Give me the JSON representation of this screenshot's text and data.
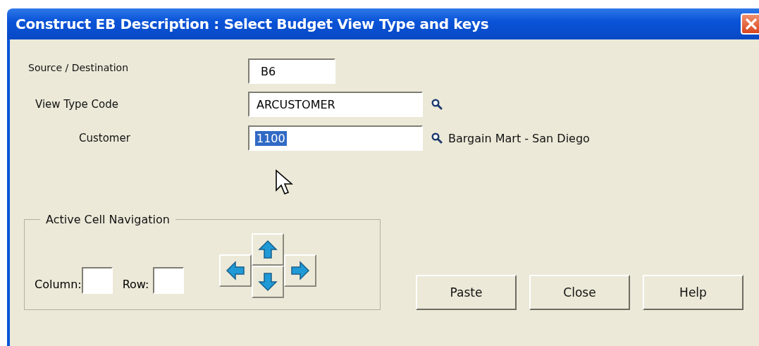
{
  "window": {
    "title": "Construct EB Description : Select Budget View Type and keys"
  },
  "fields": [
    {
      "kind": "short",
      "label": "Source / Destination",
      "value": "B6",
      "value_selected": false,
      "lookup": false
    },
    {
      "kind": "view",
      "label": "View Type Code",
      "value": "ARCUSTOMER",
      "value_selected": false,
      "lookup": true
    },
    {
      "kind": "key",
      "label": "Customer",
      "value": "1100",
      "value_selected": true,
      "lookup": true,
      "description": "Bargain Mart - San Diego"
    }
  ],
  "navigation": {
    "title": "Active Cell Navigation",
    "column_label": "Column:",
    "row_label": "Row:"
  },
  "buttons": [
    "Paste",
    "Close",
    "Help"
  ]
}
